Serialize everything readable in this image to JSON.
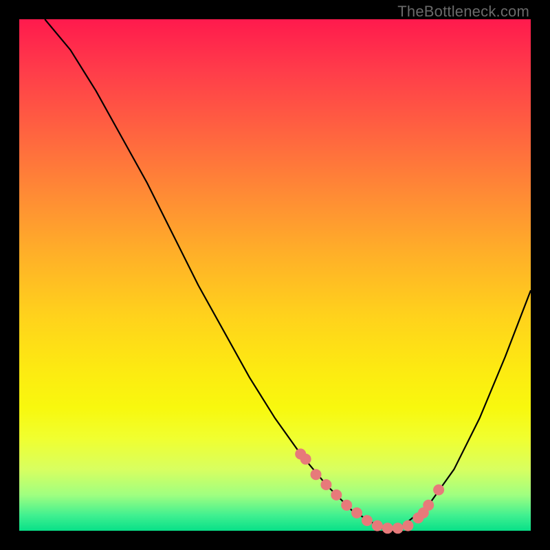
{
  "watermark": "TheBottleneck.com",
  "chart_data": {
    "type": "line",
    "title": "",
    "xlabel": "",
    "ylabel": "",
    "xlim": [
      0,
      100
    ],
    "ylim": [
      0,
      100
    ],
    "series": [
      {
        "name": "curve",
        "x": [
          5,
          10,
          15,
          20,
          25,
          30,
          35,
          40,
          45,
          50,
          55,
          60,
          65,
          70,
          72,
          75,
          80,
          85,
          90,
          95,
          100
        ],
        "values": [
          100,
          94,
          86,
          77,
          68,
          58,
          48,
          39,
          30,
          22,
          15,
          9,
          4,
          1,
          0,
          1,
          5,
          12,
          22,
          34,
          47
        ]
      }
    ],
    "points": {
      "name": "markers",
      "x": [
        55,
        56,
        58,
        60,
        62,
        64,
        66,
        68,
        70,
        72,
        74,
        76,
        78,
        79,
        80,
        82
      ],
      "values": [
        15,
        14,
        11,
        9,
        7,
        5,
        3.5,
        2,
        1,
        0.5,
        0.5,
        1,
        2.5,
        3.5,
        5,
        8
      ]
    },
    "colors": {
      "curve": "#000000",
      "markers": "#e77a7a"
    }
  }
}
